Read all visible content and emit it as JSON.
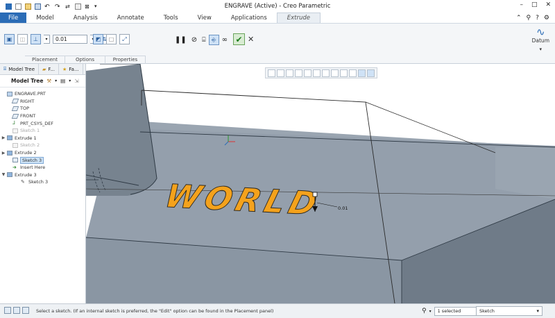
{
  "window": {
    "title": "ENGRAVE (Active) - Creo Parametric"
  },
  "menu": {
    "tabs": [
      "File",
      "Model",
      "Analysis",
      "Annotate",
      "Tools",
      "View",
      "Applications"
    ],
    "active_tab": "Extrude"
  },
  "ribbon": {
    "depth_value": "0.01",
    "subtabs": [
      "Placement",
      "Options",
      "Properties"
    ],
    "datum_label": "Datum"
  },
  "sidebar": {
    "tabs": [
      "Model Tree",
      "F...",
      "Fa..."
    ],
    "toolbar_label": "Model Tree",
    "tree": [
      {
        "label": "ENGRAVE.PRT",
        "state": "normal"
      },
      {
        "label": "RIGHT",
        "state": "normal"
      },
      {
        "label": "TOP",
        "state": "normal"
      },
      {
        "label": "FRONT",
        "state": "normal"
      },
      {
        "label": "PRT_CSYS_DEF",
        "state": "normal"
      },
      {
        "label": "Sketch 1",
        "state": "dim"
      },
      {
        "label": "Extrude 1",
        "state": "normal"
      },
      {
        "label": "Sketch 2",
        "state": "dim"
      },
      {
        "label": "Extrude 2",
        "state": "normal"
      },
      {
        "label": "Sketch 3",
        "state": "selected"
      },
      {
        "label": "Insert Here",
        "state": "insert"
      },
      {
        "label": "Extrude 3",
        "state": "normal"
      },
      {
        "label": "Sketch 3",
        "state": "normal"
      }
    ]
  },
  "viewport": {
    "engraved_text": "WORLD",
    "dimension_label": "0.01"
  },
  "status": {
    "message": "Select a sketch. (If an internal sketch is preferred, the \"Edit\" option can be found in the Placement panel)",
    "selected_count": "1 selected",
    "filter_value": "Sketch"
  },
  "colors": {
    "accent": "#2b6cb6",
    "model_face": "#8e9aa7",
    "engrave_fill": "#f4a21c"
  }
}
